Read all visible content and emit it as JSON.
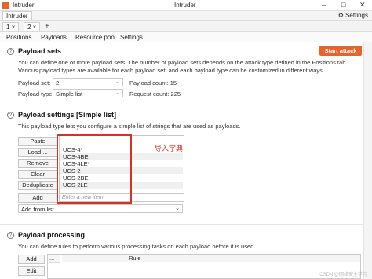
{
  "window": {
    "title_left": "Intruder",
    "title_center": "Intruder",
    "controls": [
      "–",
      "□",
      "✕"
    ]
  },
  "menubar": {
    "tab": "Intruder",
    "settings_label": "Settings"
  },
  "attack_tabs": [
    {
      "label": "1 ×"
    },
    {
      "label": "2 ×"
    }
  ],
  "add_tab": "+",
  "subtabs": [
    "Positions",
    "Payloads",
    "Resource pool",
    "Settings"
  ],
  "payload_sets": {
    "title": "Payload sets",
    "start_label": "Start attack",
    "description": "You can define one or more payload sets. The number of payload sets depends on the attack type defined in the Positions tab. Various payload types are available for each payload set, and each payload type can be customized in different ways.",
    "set_label": "Payload set:",
    "set_value": "2",
    "type_label": "Payload type:",
    "type_value": "Simple list",
    "count_label": "Payload count: 15",
    "request_label": "Request count: 225"
  },
  "payload_settings": {
    "title": "Payload settings [Simple list]",
    "description": "This payload type lets you configure a simple list of strings that are used as payloads.",
    "buttons": {
      "paste": "Paste",
      "load": "Load ...",
      "remove": "Remove",
      "clear": "Clear",
      "deduplicate": "Deduplicate",
      "add": "Add"
    },
    "items": [
      "UCS-4*",
      "UCS-4BE",
      "UCS-4LE*",
      "UCS-2",
      "UCS-2BE",
      "UCS-2LE"
    ],
    "new_item_placeholder": "Enter a new item",
    "add_from_list": "Add from list ...",
    "annotation": "导入字典"
  },
  "payload_processing": {
    "title": "Payload processing",
    "description": "You can define rules to perform various processing tasks on each payload before it is used.",
    "add": "Add",
    "edit": "Edit",
    "col_rule": "Rule",
    "col_dots": "..."
  },
  "watermark": "CSDN @网络安全学习",
  "colors": {
    "accent": "#e8632b",
    "annotation": "#d93025"
  }
}
